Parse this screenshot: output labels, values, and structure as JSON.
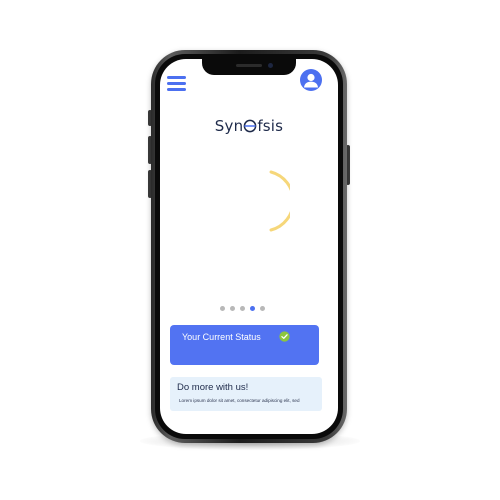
{
  "header": {
    "menu_icon": "hamburger-menu-icon",
    "profile_icon": "user-avatar-icon"
  },
  "brand": {
    "prefix": "Syn",
    "suffix": "fsis",
    "mark_icon": "no-sign-logo-icon"
  },
  "loader": {
    "icon": "loading-arc-spinner",
    "color": "#f6d77a"
  },
  "carousel": {
    "page_count": 5,
    "active_index": 4
  },
  "status_card": {
    "label": "Your Current Status",
    "status_icon": "check-circle-icon",
    "status_color": "#8cc63f"
  },
  "promo_card": {
    "title": "Do more with us!",
    "body": "Lorem ipsum dolor sit amet, consectetur adipiscing elit, sed"
  },
  "colors": {
    "accent": "#4c70f0",
    "status_card_bg": "#5273f2",
    "promo_bg": "#e6f1fb",
    "text_dark": "#1e2a4a"
  }
}
